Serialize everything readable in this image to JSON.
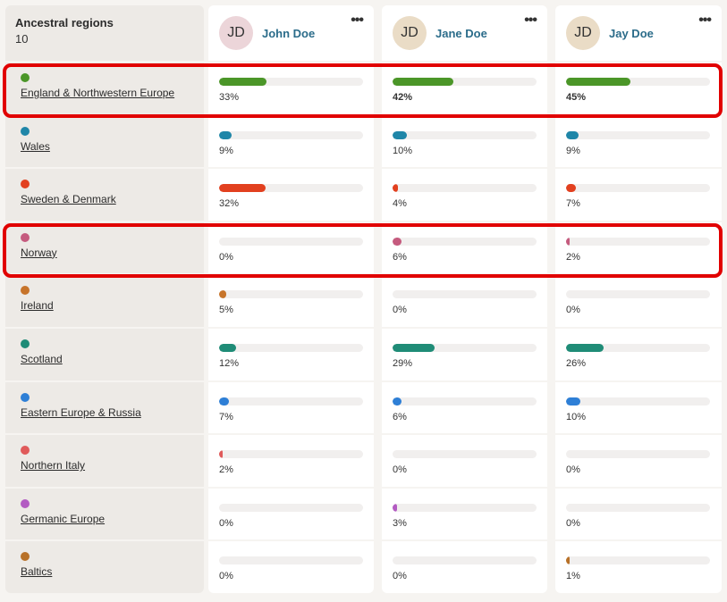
{
  "sidebar": {
    "title": "Ancestral regions",
    "count": "10"
  },
  "people": [
    {
      "initials": "JD",
      "name": "John Doe",
      "avatar_bg": "#ecd5d9"
    },
    {
      "initials": "JD",
      "name": "Jane Doe",
      "avatar_bg": "#eadcc6"
    },
    {
      "initials": "JD",
      "name": "Jay Doe",
      "avatar_bg": "#eadcc6"
    }
  ],
  "more_label": "•••",
  "regions": [
    {
      "name": "England & Northwestern Europe",
      "color": "#4b9628",
      "values": [
        "33%",
        "42%",
        "45%"
      ],
      "fractions": [
        0.33,
        0.42,
        0.45
      ],
      "highlighted": true,
      "bold": [
        false,
        true,
        true
      ]
    },
    {
      "name": "Wales",
      "color": "#1f86a8",
      "values": [
        "9%",
        "10%",
        "9%"
      ],
      "fractions": [
        0.09,
        0.1,
        0.09
      ],
      "highlighted": false
    },
    {
      "name": "Sweden & Denmark",
      "color": "#e2401f",
      "values": [
        "32%",
        "4%",
        "7%"
      ],
      "fractions": [
        0.32,
        0.04,
        0.07
      ],
      "highlighted": false
    },
    {
      "name": "Norway",
      "color": "#c55b7e",
      "values": [
        "0%",
        "6%",
        "2%"
      ],
      "fractions": [
        0,
        0.06,
        0.02
      ],
      "highlighted": true
    },
    {
      "name": "Ireland",
      "color": "#c7742a",
      "values": [
        "5%",
        "0%",
        "0%"
      ],
      "fractions": [
        0.05,
        0,
        0
      ],
      "highlighted": false
    },
    {
      "name": "Scotland",
      "color": "#1f8c77",
      "values": [
        "12%",
        "29%",
        "26%"
      ],
      "fractions": [
        0.12,
        0.29,
        0.26
      ],
      "highlighted": false
    },
    {
      "name": "Eastern Europe & Russia",
      "color": "#2e7fd6",
      "values": [
        "7%",
        "6%",
        "10%"
      ],
      "fractions": [
        0.07,
        0.06,
        0.1
      ],
      "highlighted": false
    },
    {
      "name": "Northern Italy",
      "color": "#e05a5a",
      "values": [
        "2%",
        "0%",
        "0%"
      ],
      "fractions": [
        0.02,
        0,
        0
      ],
      "highlighted": false
    },
    {
      "name": "Germanic Europe",
      "color": "#b35bc2",
      "values": [
        "0%",
        "3%",
        "0%"
      ],
      "fractions": [
        0,
        0.03,
        0
      ],
      "highlighted": false
    },
    {
      "name": "Baltics",
      "color": "#b87128",
      "values": [
        "0%",
        "0%",
        "1%"
      ],
      "fractions": [
        0,
        0,
        0.01
      ],
      "highlighted": false
    }
  ]
}
